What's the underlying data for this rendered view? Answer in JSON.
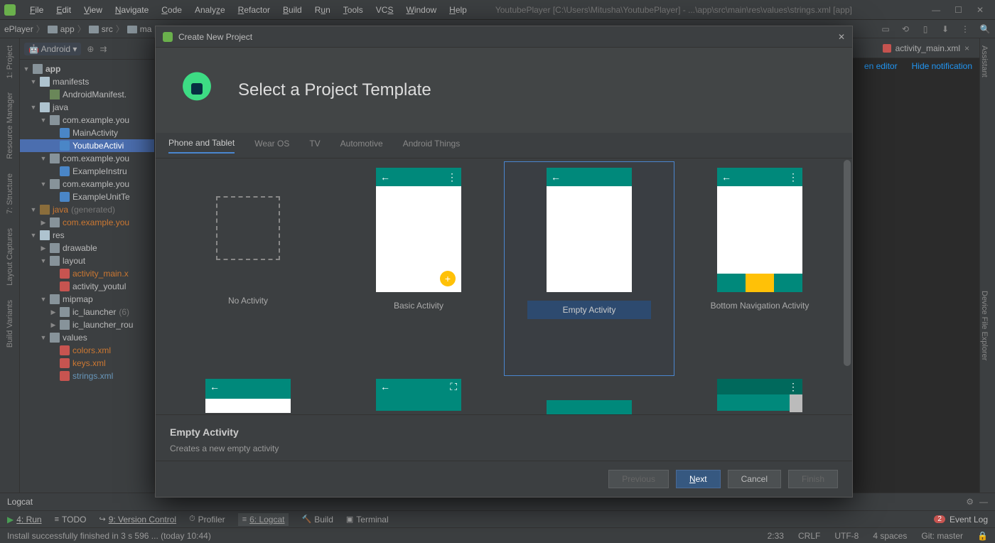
{
  "menu": {
    "items": [
      "File",
      "Edit",
      "View",
      "Navigate",
      "Code",
      "Analyze",
      "Refactor",
      "Build",
      "Run",
      "Tools",
      "VCS",
      "Window",
      "Help"
    ],
    "title": "YoutubePlayer [C:\\Users\\Mitusha\\YoutubePlayer] - ...\\app\\src\\main\\res\\values\\strings.xml [app]"
  },
  "crumbs": [
    "ePlayer",
    "app",
    "src",
    "ma"
  ],
  "toolbar": {
    "android": "Android"
  },
  "leftSide": [
    "1: Project",
    "Resource Manager",
    "7: Structure",
    "Layout Captures",
    "Build Variants"
  ],
  "rightSide": [
    "Assistant",
    "Device File Explorer"
  ],
  "tree": {
    "root": "app",
    "nodes": {
      "manifests": "manifests",
      "androidManifest": "AndroidManifest.",
      "java": "java",
      "pkg1": "com.example.you",
      "mainActivity": "MainActivity",
      "youtubeActivity": "YoutubeActivi",
      "pkg2": "com.example.you",
      "exampleInstru": "ExampleInstru",
      "pkg3": "com.example.you",
      "exampleUnit": "ExampleUnitTe",
      "javaGen": "java",
      "javaGenHint": "(generated)",
      "pkgGen": "com.example.you",
      "res": "res",
      "drawable": "drawable",
      "layout": "layout",
      "activityMain": "activity_main.x",
      "activityYoutube": "activity_youtul",
      "mipmap": "mipmap",
      "icLauncher": "ic_launcher",
      "icLauncherCount": "(6)",
      "icLauncherRound": "ic_launcher_rou",
      "values": "values",
      "colorsXml": "colors.xml",
      "keysXml": "keys.xml",
      "stringsXml": "strings.xml"
    }
  },
  "editorTabs": {
    "activityMain": "activity_main.xml"
  },
  "banner": {
    "open": "en editor",
    "hide": "Hide notification"
  },
  "dialog": {
    "title": "Create New Project",
    "heading": "Select a Project Template",
    "tabs": [
      "Phone and Tablet",
      "Wear OS",
      "TV",
      "Automotive",
      "Android Things"
    ],
    "templates": [
      "No Activity",
      "Basic Activity",
      "Empty Activity",
      "Bottom Navigation Activity"
    ],
    "selectedTitle": "Empty Activity",
    "selectedDesc": "Creates a new empty activity",
    "buttons": {
      "previous": "Previous",
      "next": "Next",
      "cancel": "Cancel",
      "finish": "Finish"
    }
  },
  "logcat": {
    "label": "Logcat"
  },
  "bottomTools": {
    "run": "4: Run",
    "todo": "TODO",
    "vcs": "9: Version Control",
    "profiler": "Profiler",
    "logcat": "6: Logcat",
    "build": "Build",
    "terminal": "Terminal",
    "eventCount": "2",
    "eventLog": "Event Log"
  },
  "status": {
    "msg": "Install successfully finished in 3 s 596 ... (today 10:44)",
    "pos": "2:33",
    "sep": "CRLF",
    "enc": "UTF-8",
    "indent": "4 spaces",
    "git": "Git: master"
  }
}
